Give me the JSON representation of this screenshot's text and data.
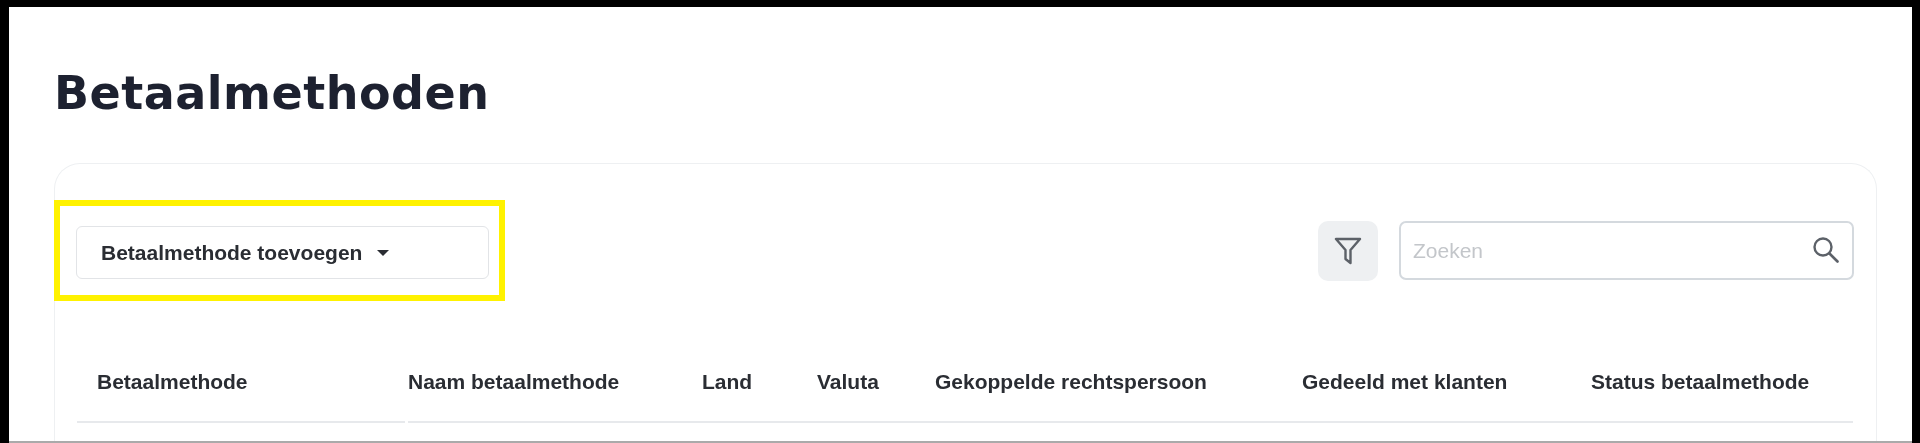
{
  "page": {
    "title": "Betaalmethoden"
  },
  "toolbar": {
    "add_button": {
      "label": "Betaalmethode toevoegen",
      "highlighted": true
    },
    "search": {
      "placeholder": "Zoeken"
    }
  },
  "table": {
    "columns": [
      {
        "label": "Betaalmethode"
      },
      {
        "label": "Naam betaalmethode"
      },
      {
        "label": "Land"
      },
      {
        "label": "Valuta"
      },
      {
        "label": "Gekoppelde rechtspersoon"
      },
      {
        "label": "Gedeeld met klanten"
      },
      {
        "label": "Status betaalmethode"
      }
    ]
  }
}
